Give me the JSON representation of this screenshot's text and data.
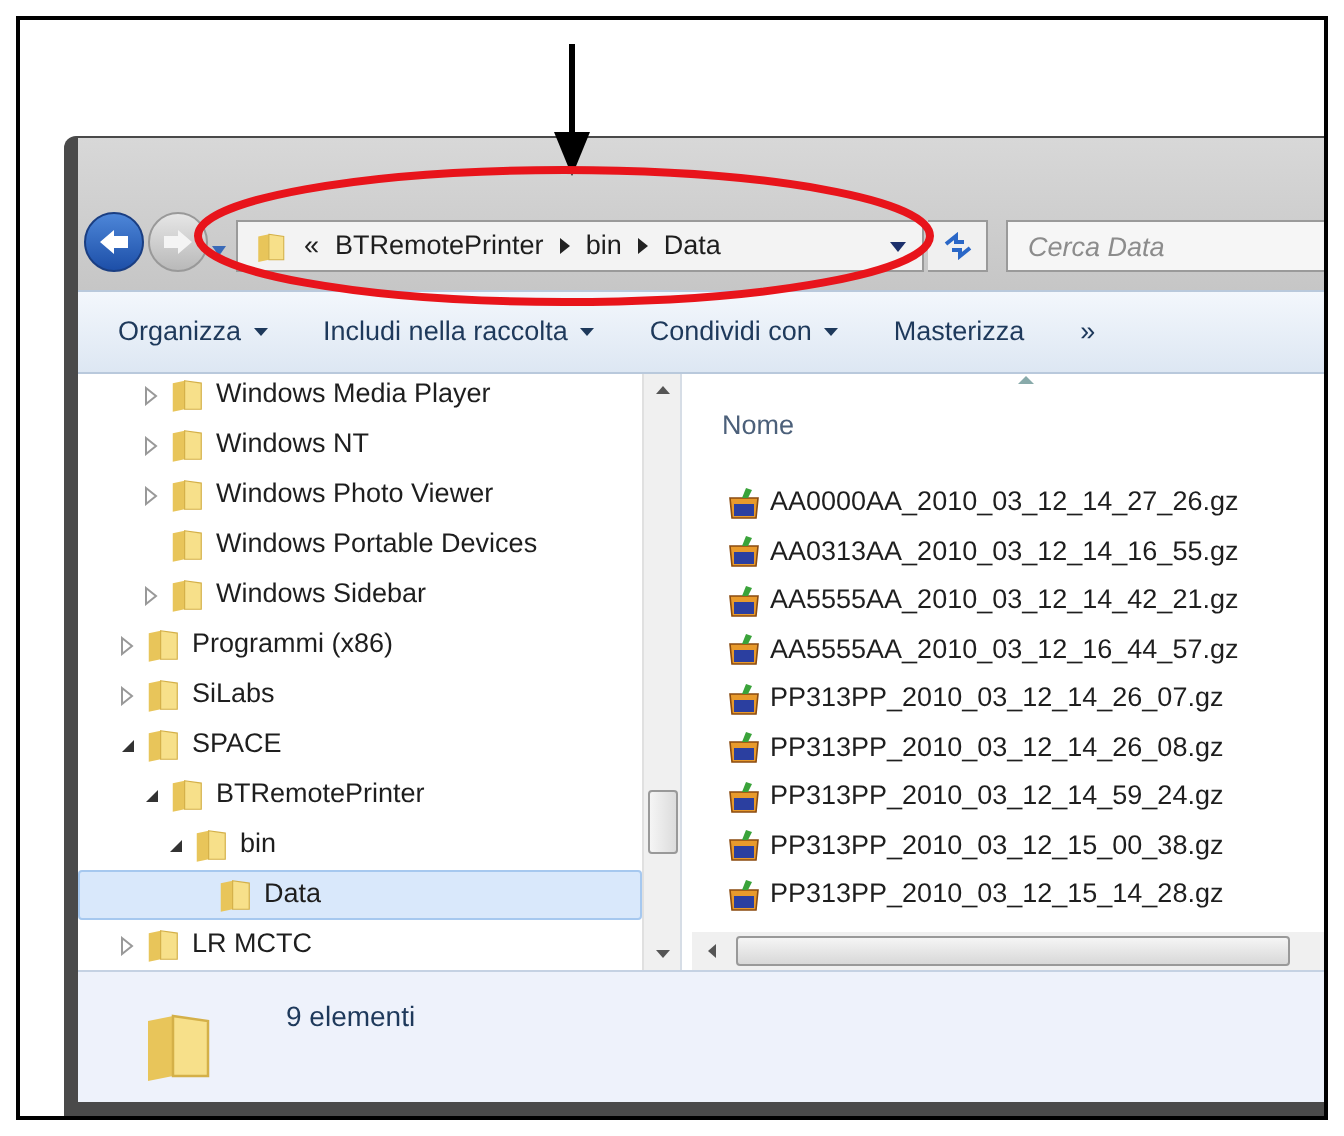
{
  "address_bar": {
    "overflow_mark": "«",
    "segments": [
      "BTRemotePrinter",
      "bin",
      "Data"
    ]
  },
  "search": {
    "placeholder": "Cerca Data"
  },
  "toolbar": [
    {
      "label": "Organizza",
      "dropdown": true
    },
    {
      "label": "Includi nella raccolta",
      "dropdown": true
    },
    {
      "label": "Condividi con",
      "dropdown": true
    },
    {
      "label": "Masterizza",
      "dropdown": false
    },
    {
      "label": "»",
      "dropdown": false
    }
  ],
  "tree": [
    {
      "children": [
        {
          "label": "Windows Media Player",
          "expandable": true,
          "expanded": false,
          "selected": false
        },
        {
          "label": "Windows NT",
          "expandable": true,
          "expanded": false,
          "selected": false
        },
        {
          "label": "Windows Photo Viewer",
          "expandable": true,
          "expanded": false,
          "selected": false
        },
        {
          "label": "Windows Portable Devices",
          "expandable": false,
          "selected": false
        },
        {
          "label": "Windows Sidebar",
          "expandable": true,
          "expanded": false,
          "selected": false
        }
      ]
    },
    {
      "label": "Programmi (x86)",
      "expandable": true,
      "expanded": false,
      "selected": false
    },
    {
      "label": "SiLabs",
      "expandable": true,
      "expanded": false,
      "selected": false
    },
    {
      "label": "SPACE",
      "expandable": true,
      "expanded": true,
      "selected": false,
      "children": [
        {
          "label": "BTRemotePrinter",
          "expandable": true,
          "expanded": true,
          "selected": false,
          "children": [
            {
              "label": "bin",
              "expandable": true,
              "expanded": true,
              "selected": false,
              "children": [
                {
                  "label": "Data",
                  "expandable": false,
                  "selected": true
                }
              ]
            }
          ]
        }
      ]
    },
    {
      "label": "LR MCTC",
      "expandable": true,
      "expanded": false,
      "selected": false
    }
  ],
  "file_list": {
    "column": "Nome",
    "files": [
      "AA0000AA_2010_03_12_14_27_26.gz",
      "AA0313AA_2010_03_12_14_16_55.gz",
      "AA5555AA_2010_03_12_14_42_21.gz",
      "AA5555AA_2010_03_12_16_44_57.gz",
      "PP313PP_2010_03_12_14_26_07.gz",
      "PP313PP_2010_03_12_14_26_08.gz",
      "PP313PP_2010_03_12_14_59_24.gz",
      "PP313PP_2010_03_12_15_00_38.gz",
      "PP313PP_2010_03_12_15_14_28.gz"
    ]
  },
  "status_bar": {
    "text": "9 elementi"
  }
}
